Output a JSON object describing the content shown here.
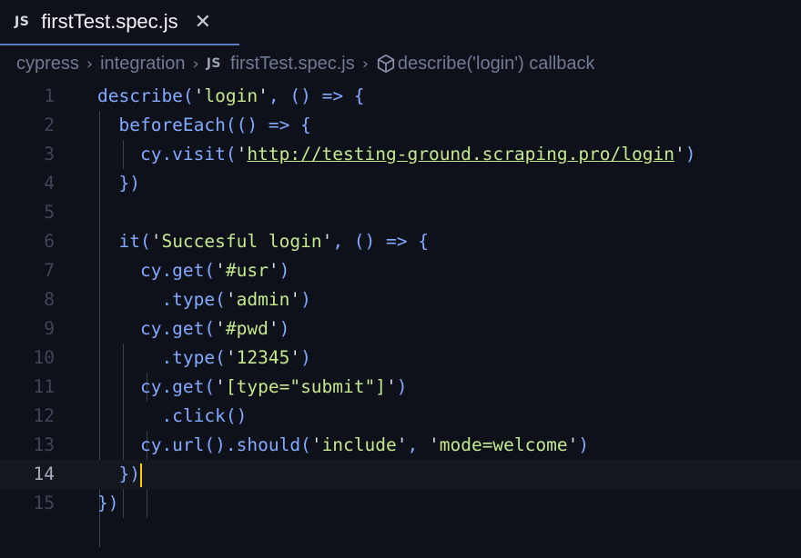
{
  "tab": {
    "badge": "JS",
    "title": "firstTest.spec.js",
    "close": "✕"
  },
  "breadcrumb": {
    "parts": [
      "cypress",
      "integration"
    ],
    "file_badge": "JS",
    "file": "firstTest.spec.js",
    "symbol": "describe('login') callback"
  },
  "editor": {
    "active_line": 14,
    "lines": [
      {
        "n": "1",
        "text": "describe('login', () => {"
      },
      {
        "n": "2",
        "text": "  beforeEach(() => {"
      },
      {
        "n": "3",
        "text": "    cy.visit('http://testing-ground.scraping.pro/login')"
      },
      {
        "n": "4",
        "text": "  })"
      },
      {
        "n": "5",
        "text": ""
      },
      {
        "n": "6",
        "text": "  it('Succesful login', () => {"
      },
      {
        "n": "7",
        "text": "    cy.get('#usr')"
      },
      {
        "n": "8",
        "text": "      .type('admin')"
      },
      {
        "n": "9",
        "text": "    cy.get('#pwd')"
      },
      {
        "n": "10",
        "text": "      .type('12345')"
      },
      {
        "n": "11",
        "text": "    cy.get('[type=\"submit\"]')"
      },
      {
        "n": "12",
        "text": "      .click()"
      },
      {
        "n": "13",
        "text": "    cy.url().should('include', 'mode=welcome')"
      },
      {
        "n": "14",
        "text": "  })"
      },
      {
        "n": "15",
        "text": "})"
      }
    ]
  },
  "colors": {
    "background": "#0f111a",
    "keyword": "#82aaff",
    "string": "#c3e88d",
    "tab_underline": "#5b7fc6",
    "cursor": "#ffcc00"
  }
}
